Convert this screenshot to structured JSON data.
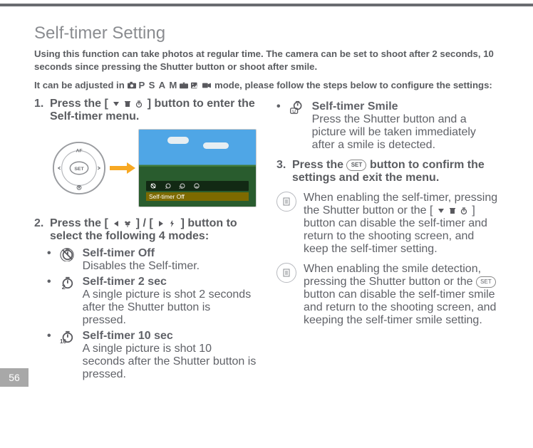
{
  "page_number": "56",
  "title": "Self-timer Setting",
  "intro1": "Using this function can take photos at regular time. The camera can be set to shoot after 2 seconds, 10 seconds since pressing the Shutter button or shoot after smile.",
  "intro2a": "It can be adjusted in ",
  "intro2b": " mode, please follow the steps below to configure the settings:",
  "mode_letters": "P S A M",
  "step1_a": "Press the [",
  "step1_b": "] button to enter the Self-timer menu.",
  "overlay_label": "Self-timer Off",
  "step2_a": "Press the [",
  "step2_b": "] / [",
  "step2_c": "] button to select the following 4 modes:",
  "modes": [
    {
      "title": "Self-timer Off",
      "desc": "Disables the Self-timer."
    },
    {
      "title": "Self-timer 2 sec",
      "desc": "A single picture is shot 2 seconds after the Shutter button is pressed."
    },
    {
      "title": "Self-timer 10 sec",
      "desc": "A single picture is shot 10 seconds after the Shutter button is pressed."
    },
    {
      "title": "Self-timer Smile",
      "desc": "Press the Shutter button and a picture will be taken immediately after a smile is detected."
    }
  ],
  "step3_a": "Press the ",
  "step3_b": " button to confirm the settings and exit the menu.",
  "set_label": "SET",
  "note1_a": "When enabling the self-timer, pressing the Shutter button or the [",
  "note1_b": "] button can disable the self-timer and return to the shooting screen, and keep the self-timer setting.",
  "note2_a": "When enabling the smile detection, pressing the Shutter button or the ",
  "note2_b": " button can disable the self-timer smile and return to the shooting screen, and keeping the self-timer smile setting.",
  "icons": {
    "down": "down-triangle",
    "trash": "trash-can",
    "timer": "timer-clock",
    "left_macro": "left-flower",
    "right_flash": "right-bolt",
    "set_btn": "set-button",
    "camera": "camera",
    "scene": "scene-picture",
    "video": "video-camera",
    "face": "smile-face",
    "arrow": "orange-right-arrow",
    "note": "document-lines",
    "cross": "crossed-circle"
  }
}
